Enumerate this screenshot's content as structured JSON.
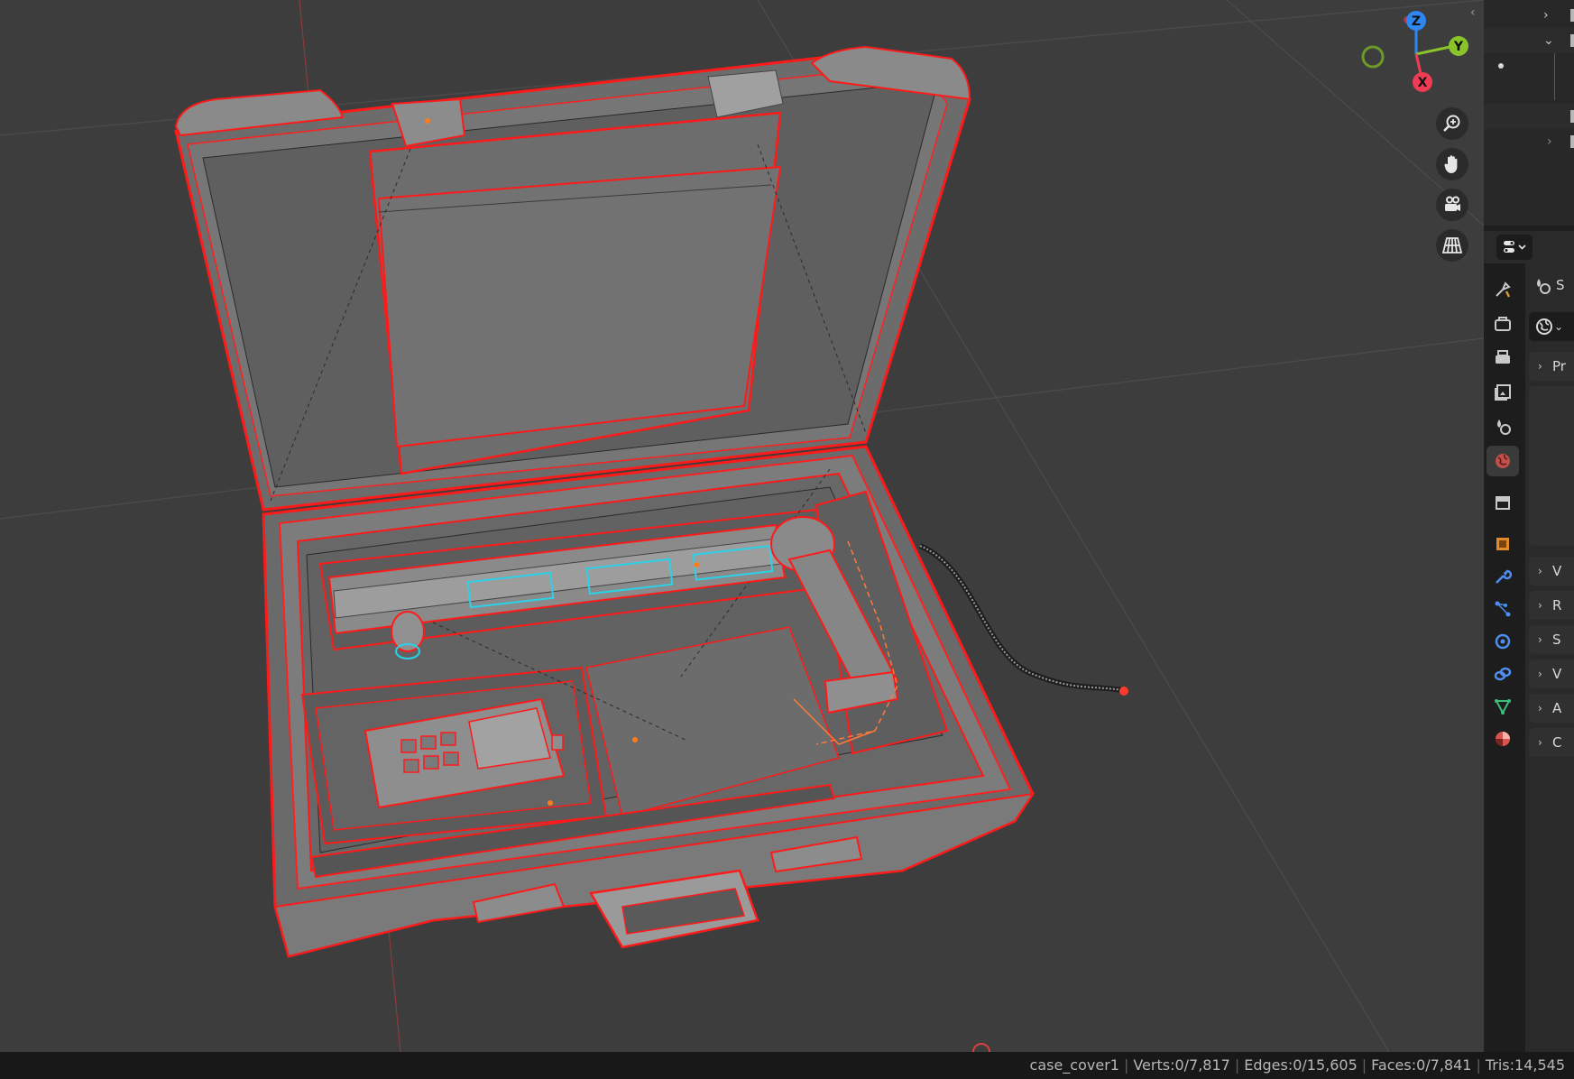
{
  "viewport": {
    "axes": {
      "z": "Z",
      "y": "Y",
      "x": "X"
    },
    "colors": {
      "x_axis": "#f03b55",
      "y_axis": "#8bc32b",
      "z_axis": "#2e86f0",
      "outline": "#ff1a1a",
      "selected_edge": "#2ad2e8",
      "object_origin": "#ff7a1a"
    }
  },
  "nav_buttons": [
    "zoom-icon",
    "hand-pan-icon",
    "camera-icon",
    "grid-icon"
  ],
  "properties_tabs": [
    "tool-icon",
    "render-icon",
    "output-icon",
    "view-layer-icon",
    "scene-icon",
    "world-icon",
    "collection-icon",
    "object-icon",
    "modifier-icon",
    "particles-icon",
    "physics-icon",
    "constraints-icon",
    "data-icon",
    "material-icon"
  ],
  "properties_panels": {
    "context_label": "S",
    "sections": [
      {
        "label": "Pr",
        "open": false
      },
      {
        "label": "S",
        "open": true
      },
      {
        "label": "V",
        "open": false
      },
      {
        "label": "R",
        "open": false
      },
      {
        "label": "S",
        "open": false
      },
      {
        "label": "V",
        "open": false
      },
      {
        "label": "A",
        "open": false
      },
      {
        "label": "C",
        "open": false
      }
    ]
  },
  "status": {
    "object": "case_cover1",
    "verts": "Verts:0/7,817",
    "edges": "Edges:0/15,605",
    "faces": "Faces:0/7,841",
    "tris": "Tris:14,545"
  }
}
